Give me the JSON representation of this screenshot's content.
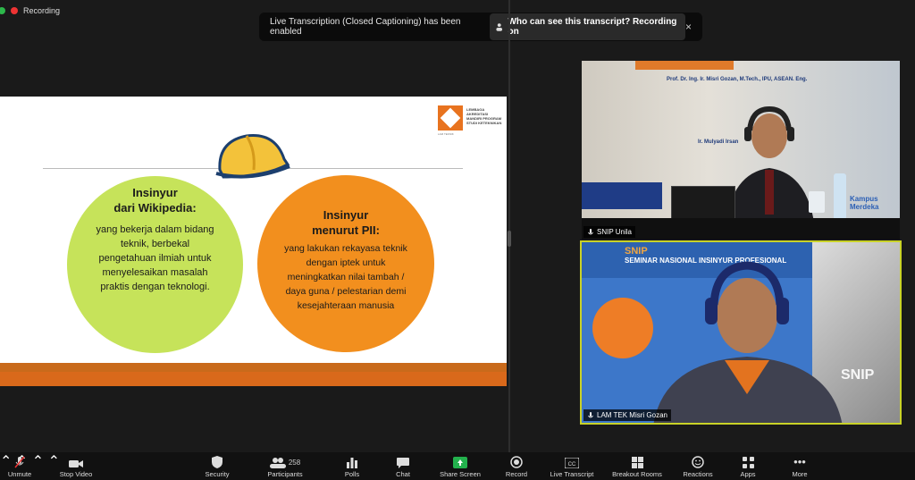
{
  "recording": {
    "label": "Recording"
  },
  "banner": {
    "message": "Live Transcription (Closed Captioning) has been enabled",
    "who_label": "Who can see this transcript? Recording on",
    "close": "×"
  },
  "slide": {
    "logo_text": "LEMBAGA AKREDITASI MANDIRI PROGRAM STUDI KETEKNIKAN",
    "logo_sub": "LAM TEKNIK",
    "circle1": {
      "title_line1": "Insinyur",
      "title_line2": "dari Wikipedia:",
      "body": [
        "yang bekerja dalam bidang",
        "teknik, berbekal",
        "pengetahuan ilmiah untuk",
        "menyelesaikan masalah",
        "praktis  dengan teknologi."
      ]
    },
    "circle2": {
      "title_line1": "Insinyur",
      "title_line2": "menurut PII:",
      "body": [
        "yang lakukan rekayasa teknik",
        "dengan iptek untuk",
        "meningkatkan nilai tambah /",
        "daya guna / pelestarian demi",
        "kesejahteraan manusia"
      ]
    },
    "colors": {
      "circle1": "#c6e35a",
      "circle2": "#f28f1e",
      "band": "#d9691b"
    }
  },
  "video1": {
    "name": "SNIP Unila",
    "backdrop_header": "Prof. Dr. Ing. Ir. Misri Gozan, M.Tech., IPU, ASEAN. Eng.",
    "backdrop_sub": "Ir. Mulyadi Irsan",
    "backdrop_logo": "Kampus Merdeka"
  },
  "video2": {
    "name": "LAM TEK Misri Gozan",
    "backdrop_snip": "SNIP",
    "backdrop_seminar": "SEMINAR NASIONAL INSINYUR PROFESIONAL",
    "backdrop_snip2": "SNIP"
  },
  "toolbar": {
    "unmute": "Unmute",
    "stop_video": "Stop Video",
    "security": "Security",
    "participants": "Participants",
    "participants_count": "258",
    "polls": "Polls",
    "chat": "Chat",
    "share_screen": "Share Screen",
    "record": "Record",
    "live_transcript": "Live Transcript",
    "breakout_rooms": "Breakout Rooms",
    "reactions": "Reactions",
    "apps": "Apps",
    "more": "More"
  }
}
